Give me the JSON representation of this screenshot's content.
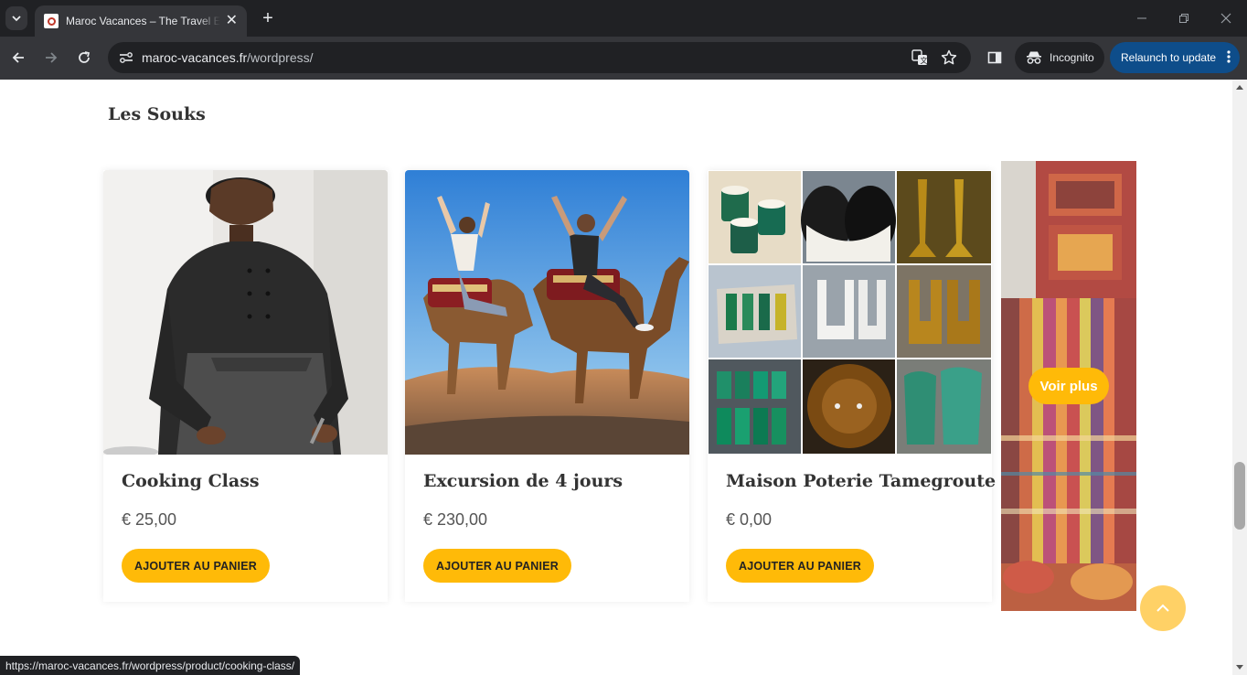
{
  "browser": {
    "tab": {
      "title": "Maroc Vacances – The Travel Ex",
      "close": "✕"
    },
    "new_tab": "+",
    "url": {
      "host": "maroc-vacances.fr",
      "path": "/wordpress/"
    },
    "incognito_label": "Incognito",
    "relaunch_label": "Relaunch to update",
    "status_url": "https://maroc-vacances.fr/wordpress/product/cooking-class/"
  },
  "page": {
    "section_title": "Les Souks",
    "products": [
      {
        "title": "Cooking Class",
        "price": "€ 25,00",
        "button": "AJOUTER AU PANIER"
      },
      {
        "title": "Excursion de 4 jours",
        "price": "€ 230,00",
        "button": "AJOUTER AU PANIER"
      },
      {
        "title": "Maison Poterie Tamegroute",
        "price": "€ 0,00",
        "button": "AJOUTER AU PANIER"
      }
    ],
    "voir_plus": "Voir plus"
  },
  "colors": {
    "accent": "#ffba08",
    "relaunch": "#0e4d8a",
    "chrome_dark": "#202124",
    "chrome_mid": "#35363a"
  },
  "icons": [
    "tab-search-icon",
    "favicon-icon",
    "back-icon",
    "forward-icon",
    "reload-icon",
    "site-info-icon",
    "translate-icon",
    "star-icon",
    "side-panel-icon",
    "incognito-icon",
    "more-vert-icon",
    "chevron-up-icon"
  ]
}
